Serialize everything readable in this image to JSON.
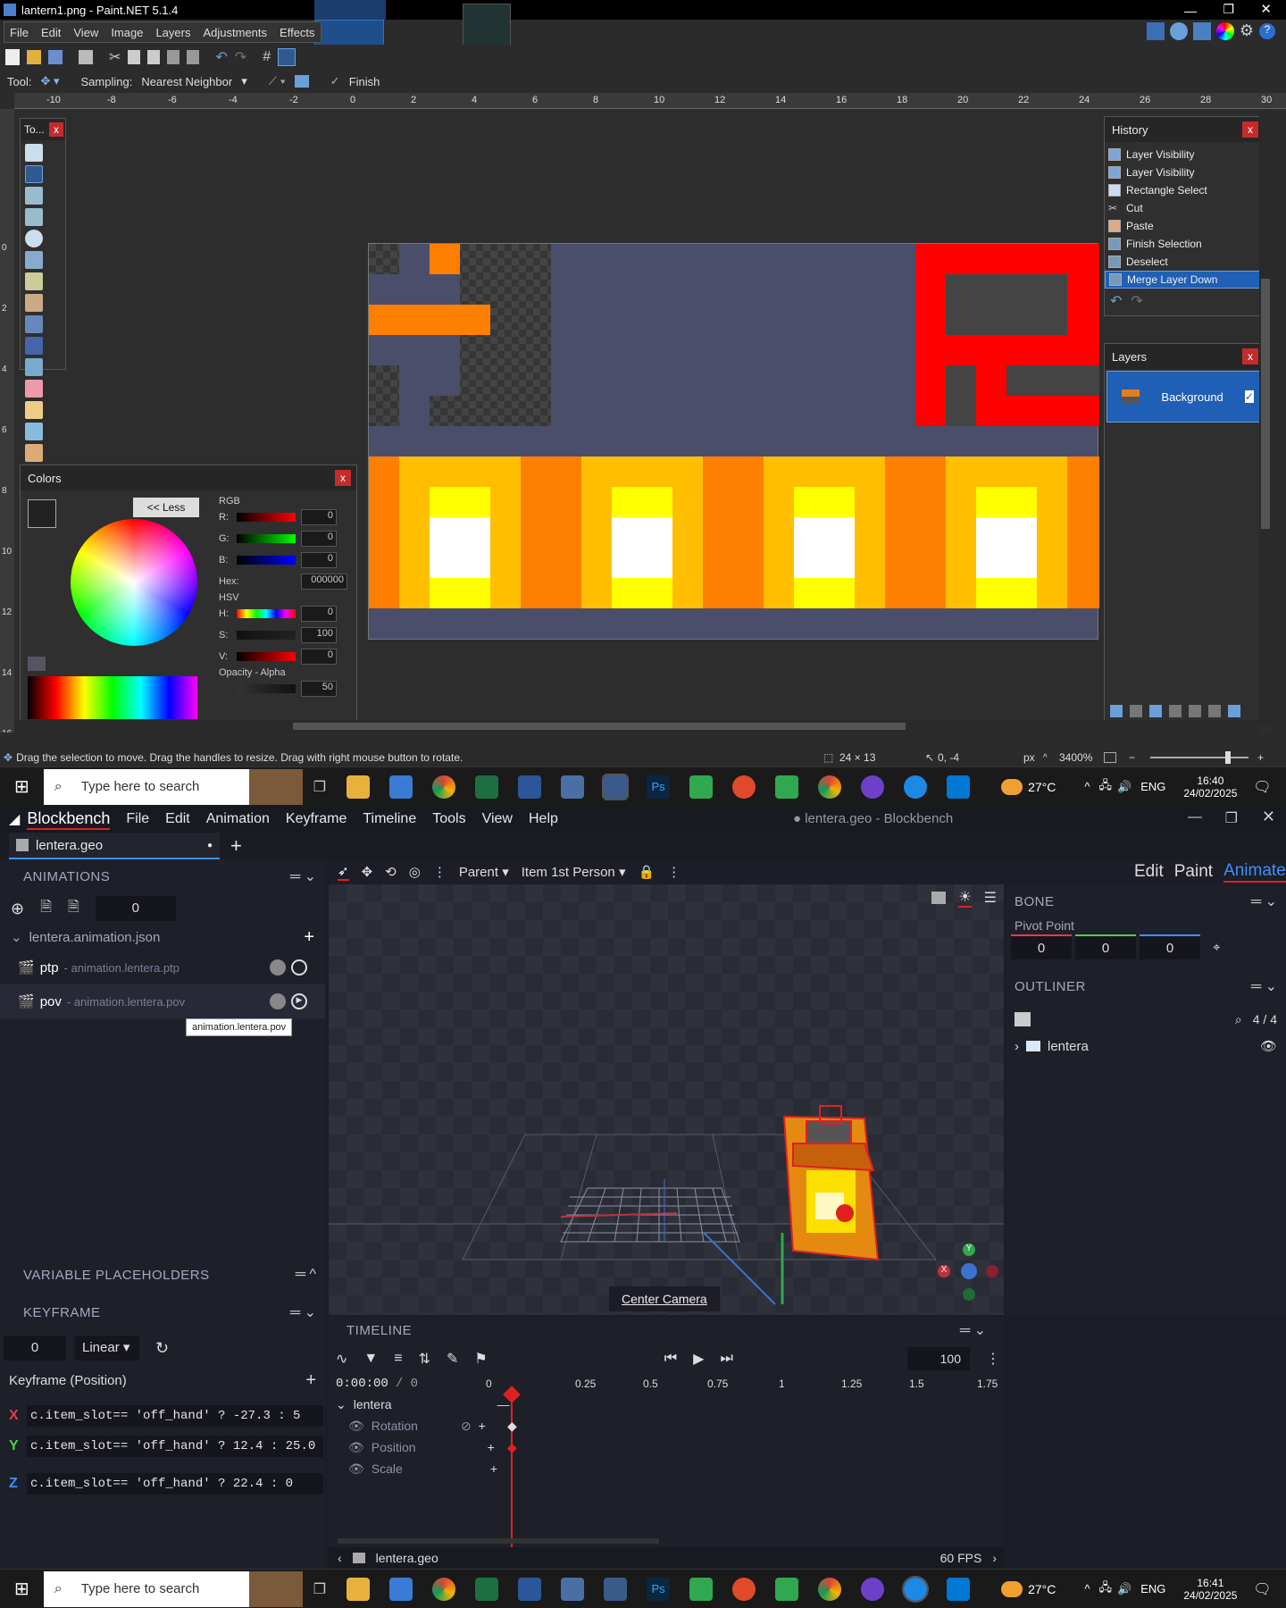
{
  "pdn": {
    "title": "lantern1.png - Paint.NET 5.1.4",
    "menu": [
      "File",
      "Edit",
      "View",
      "Image",
      "Layers",
      "Adjustments",
      "Effects"
    ],
    "options": {
      "tool_label": "Tool:",
      "sampling_label": "Sampling:",
      "sampling_value": "Nearest Neighbor",
      "finish": "Finish"
    },
    "ruler_h": [
      "px",
      "-10",
      "-8",
      "-6",
      "-4",
      "-2",
      "0",
      "2",
      "4",
      "6",
      "8",
      "10",
      "12",
      "14",
      "16",
      "18",
      "20",
      "22",
      "24",
      "26",
      "28",
      "30"
    ],
    "ruler_v": [
      "0",
      "2",
      "4",
      "6",
      "8",
      "10",
      "12",
      "14",
      "16"
    ],
    "tools_title": "To...",
    "colors": {
      "title": "Colors",
      "less_btn": "<< Less",
      "rgb_label": "RGB",
      "r_label": "R:",
      "g_label": "G:",
      "b_label": "B:",
      "r": "0",
      "g": "0",
      "b": "0",
      "hex_label": "Hex:",
      "hex": "000000",
      "hsv_label": "HSV",
      "h_label": "H:",
      "s_label": "S:",
      "v_label": "V:",
      "h": "0",
      "s": "100",
      "v": "0",
      "opacity_label": "Opacity - Alpha",
      "opacity": "50"
    },
    "history": {
      "title": "History",
      "items": [
        "Layer Visibility",
        "Layer Visibility",
        "Rectangle Select",
        "Cut",
        "Paste",
        "Finish Selection",
        "Deselect",
        "Merge Layer Down"
      ]
    },
    "layers": {
      "title": "Layers",
      "items": [
        {
          "name": "Background"
        }
      ]
    },
    "status": {
      "hint": "Drag the selection to move. Drag the handles to resize. Drag with right mouse button to rotate.",
      "size": "24 × 13",
      "pos": "0, -4",
      "unit": "px",
      "zoom": "3400%"
    }
  },
  "taskbar_top": {
    "search": "Type here to search",
    "temp": "27°C",
    "lang": "ENG",
    "time": "16:40",
    "date": "24/02/2025"
  },
  "bb": {
    "app": "Blockbench",
    "menu": [
      "File",
      "Edit",
      "Animation",
      "Keyframe",
      "Timeline",
      "Tools",
      "View",
      "Help"
    ],
    "window_title": "● lentera.geo - Blockbench",
    "tab": "lentera.geo",
    "animations": {
      "title": "ANIMATIONS",
      "counter": "0",
      "file": "lentera.animation.json",
      "items": [
        {
          "name": "ptp",
          "sub": "- animation.lentera.ptp"
        },
        {
          "name": "pov",
          "sub": "- animation.lentera.pov"
        }
      ],
      "tooltip": "animation.lentera.pov"
    },
    "toolbar": {
      "parent": "Parent",
      "item": "Item 1st Person"
    },
    "modes": [
      "Edit",
      "Paint",
      "Animate"
    ],
    "bone": {
      "title": "BONE",
      "pivot_label": "Pivot Point",
      "pivot": [
        "0",
        "0",
        "0"
      ]
    },
    "outliner": {
      "title": "OUTLINER",
      "count": "4 / 4",
      "item": "lentera"
    },
    "viewport": {
      "center_camera": "Center Camera"
    },
    "timeline": {
      "title": "TIMELINE",
      "time": "0:00:00",
      "frame": "/ 0",
      "speed": "100",
      "ticks": [
        "0",
        "0.25",
        "0.5",
        "0.75",
        "1",
        "1.25",
        "1.5",
        "1.75"
      ],
      "group": "lentera",
      "channels": [
        "Rotation",
        "Position",
        "Scale"
      ],
      "footer_file": "lentera.geo",
      "fps": "60 FPS"
    },
    "varph": {
      "title": "VARIABLE PLACEHOLDERS"
    },
    "keyframe": {
      "title": "KEYFRAME",
      "value": "0",
      "interp": "Linear",
      "section": "Keyframe (Position)",
      "axes": [
        {
          "axis": "X",
          "expr": "c.item_slot== 'off_hand' ? -27.3 : 5"
        },
        {
          "axis": "Y",
          "expr": "c.item_slot== 'off_hand' ? 12.4 : 25.0"
        },
        {
          "axis": "Z",
          "expr": "c.item_slot== 'off_hand' ? 22.4 : 0"
        }
      ]
    }
  },
  "taskbar_bottom": {
    "search": "Type here to search",
    "temp": "27°C",
    "lang": "ENG",
    "time": "16:41",
    "date": "24/02/2025"
  },
  "colors": {
    "accent_red": "#e02020",
    "bb_accent": "#3e90ff",
    "pdn_select": "#3a6fb5"
  }
}
